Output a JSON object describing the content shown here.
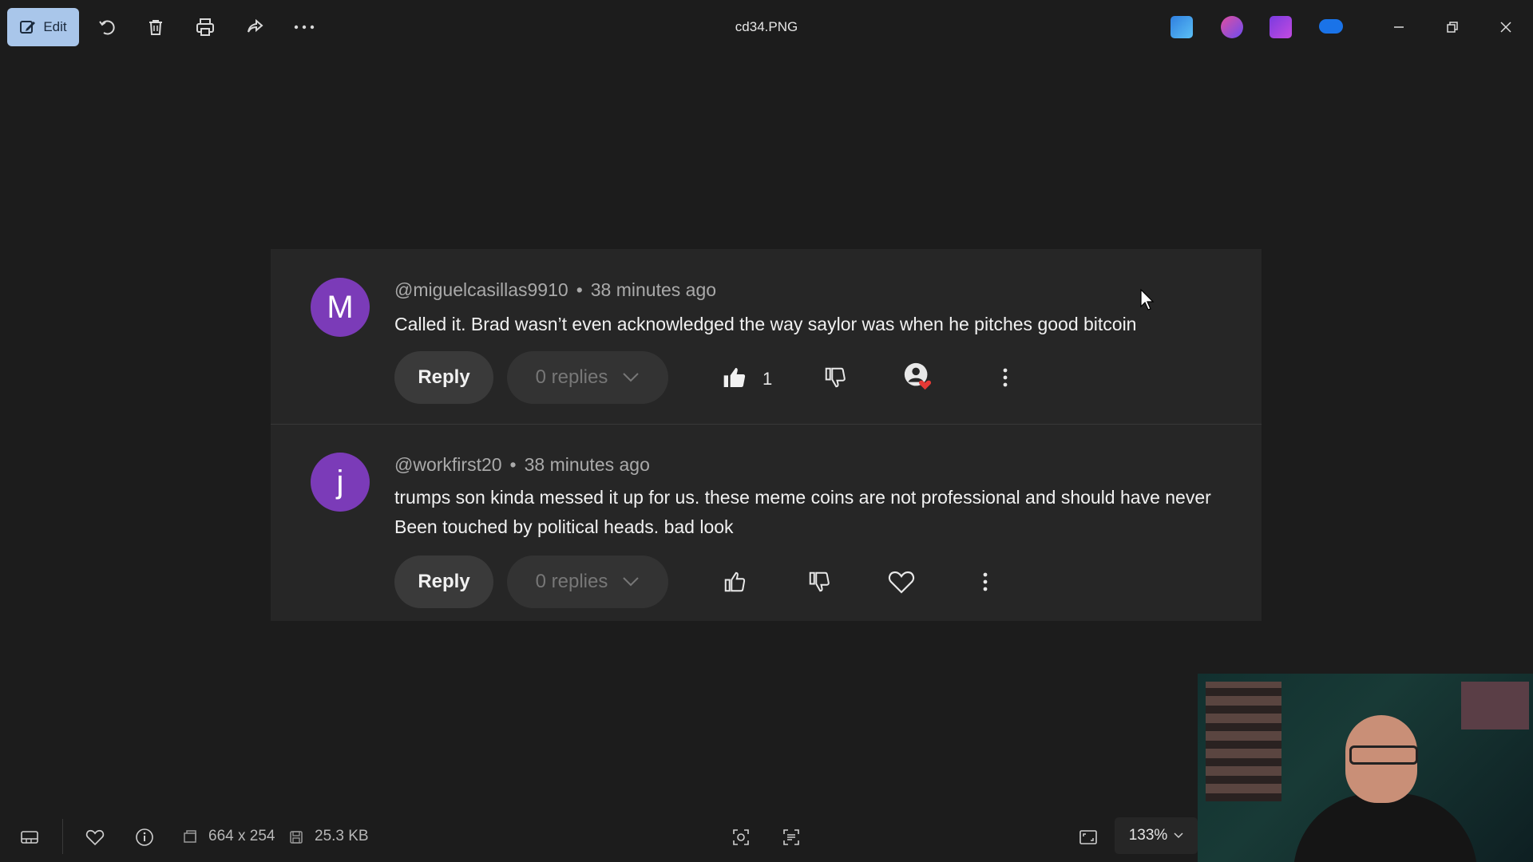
{
  "toolbar": {
    "edit_label": "Edit",
    "file_title": "cd34.PNG",
    "icons": [
      "edit-icon",
      "rotate-icon",
      "delete-icon",
      "print-icon",
      "share-icon",
      "more-icon"
    ]
  },
  "comments": [
    {
      "avatar_letter": "M",
      "handle": "@miguelcasillas9910",
      "separator": "•",
      "time": "38 minutes ago",
      "text": "Called it. Brad wasn’t even acknowledged the way saylor was when he pitches good bitcoin",
      "reply_label": "Reply",
      "replies_label": "0 replies",
      "likes": "1",
      "liked": true,
      "hearted_by_creator": true
    },
    {
      "avatar_letter": "j",
      "handle": "@workfirst20",
      "separator": "•",
      "time": "38 minutes ago",
      "text": "trumps son kinda messed it up for us. these meme coins are not professional and should have never Been touched by political heads. bad look",
      "reply_label": "Reply",
      "replies_label": "0 replies",
      "likes": "",
      "liked": false,
      "hearted_by_creator": false
    }
  ],
  "status": {
    "dimensions": "664 x 254",
    "file_size": "25.3 KB",
    "zoom": "133%"
  },
  "colors": {
    "background": "#1c1c1c",
    "card": "#262626",
    "avatar": "#7b3bb8",
    "edit_button": "#a9c6ea",
    "heart_badge": "#e53935"
  }
}
